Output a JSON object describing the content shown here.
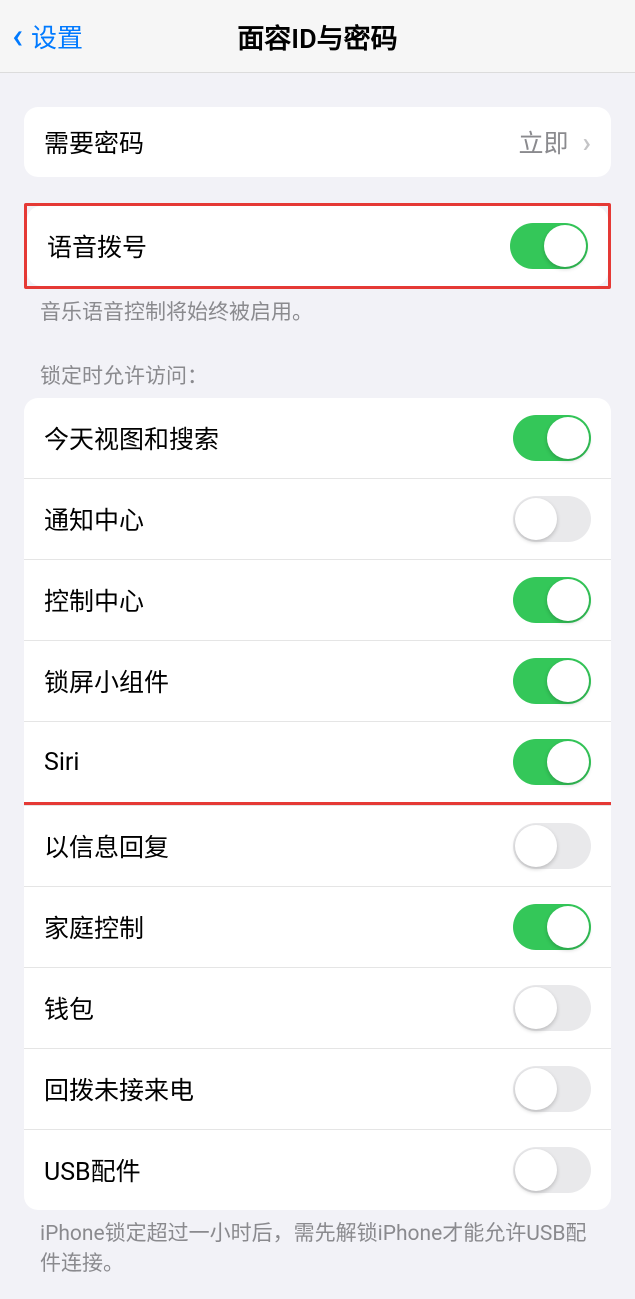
{
  "nav": {
    "back_label": "设置",
    "title": "面容ID与密码"
  },
  "require_passcode": {
    "label": "需要密码",
    "value": "立即"
  },
  "voice_dial": {
    "label": "语音拨号",
    "on": true,
    "footer": "音乐语音控制将始终被启用。"
  },
  "locked_access": {
    "header": "锁定时允许访问：",
    "items": [
      {
        "label": "今天视图和搜索",
        "on": true
      },
      {
        "label": "通知中心",
        "on": false
      },
      {
        "label": "控制中心",
        "on": true
      },
      {
        "label": "锁屏小组件",
        "on": true
      },
      {
        "label": "Siri",
        "on": true,
        "highlight": true
      },
      {
        "label": "以信息回复",
        "on": false
      },
      {
        "label": "家庭控制",
        "on": true
      },
      {
        "label": "钱包",
        "on": false
      },
      {
        "label": "回拨未接来电",
        "on": false
      },
      {
        "label": "USB配件",
        "on": false
      }
    ],
    "footer": "iPhone锁定超过一小时后，需先解锁iPhone才能允许USB配件连接。"
  }
}
